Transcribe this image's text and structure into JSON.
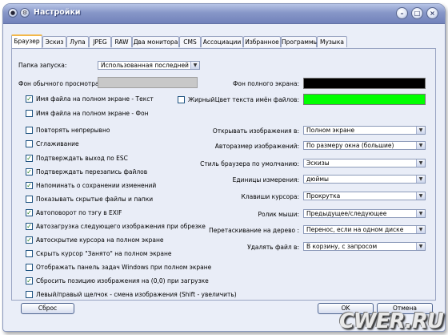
{
  "window": {
    "title": "Настройки"
  },
  "tabs": [
    "Браузер",
    "Эскиз",
    "Лупа",
    "JPEG",
    "RAW",
    "Два монитора",
    "CMS",
    "Ассоциации",
    "Избранное",
    "Программы",
    "Музыка"
  ],
  "browser": {
    "start_folder_label": "Папка запуска:",
    "start_folder_value": "Использованная последней",
    "bg_normal_label": "Фон обычного просмотра:",
    "bg_full_label": "Фон полного экрана:",
    "bg_full_color": "#000000",
    "filename_color_label": "Цвет текста имён файлов:",
    "filename_color": "#00ff00",
    "bold_label": "Жирный",
    "checkboxes": [
      {
        "label": "Имя файла на полном экране - Текст",
        "checked": true
      },
      {
        "label": "Имя файла на полном экране - Фон",
        "checked": false
      },
      {
        "label": "Повторять непрерывно",
        "checked": false
      },
      {
        "label": "Сглаживание",
        "checked": false
      },
      {
        "label": "Подтверждать выход по ESC",
        "checked": true
      },
      {
        "label": "Подтверждать перезапись файлов",
        "checked": true
      },
      {
        "label": "Напоминать о сохранении изменений",
        "checked": true
      },
      {
        "label": "Показывать скрытые файлы и папки",
        "checked": false
      },
      {
        "label": "Автоповорот по тэгу в EXIF",
        "checked": true
      },
      {
        "label": "Автозагрузка следующего изображения при обрезке",
        "checked": true
      },
      {
        "label": "Автоскрытие курсора на полном экране",
        "checked": true
      },
      {
        "label": "Скрыть курсор \"Занято\" на полном экране",
        "checked": false
      },
      {
        "label": "Отображать панель задач Windows при полном экране",
        "checked": false
      },
      {
        "label": "Сбросить позицию изображения на (0,0) при загрузке",
        "checked": true
      },
      {
        "label": "Левый/правый щелчок - смена изображения (Shift - увеличить)",
        "checked": false
      }
    ],
    "settings": [
      {
        "label": "Открывать изображения в:",
        "value": "Полном экране"
      },
      {
        "label": "Авторазмер изображений:",
        "value": "По размеру окна (большие)"
      },
      {
        "label": "Стиль браузера по умолчанию:",
        "value": "Эскизы"
      },
      {
        "label": "Единицы измерения:",
        "value": "дюймы"
      },
      {
        "label": "Клавиши курсора:",
        "value": "Прокрутка"
      },
      {
        "label": "Ролик мыши:",
        "value": "Предыдущее/следующее"
      },
      {
        "label": "Перетаскивание на дерево :",
        "value": "Перенос, если на одном диске"
      },
      {
        "label": "Удалять файл в:",
        "value": "В корзину, с запросом"
      }
    ]
  },
  "footer": {
    "reset": "Сброс",
    "ok": "OK",
    "cancel": "Отмена"
  },
  "watermark": "CWER.RU"
}
